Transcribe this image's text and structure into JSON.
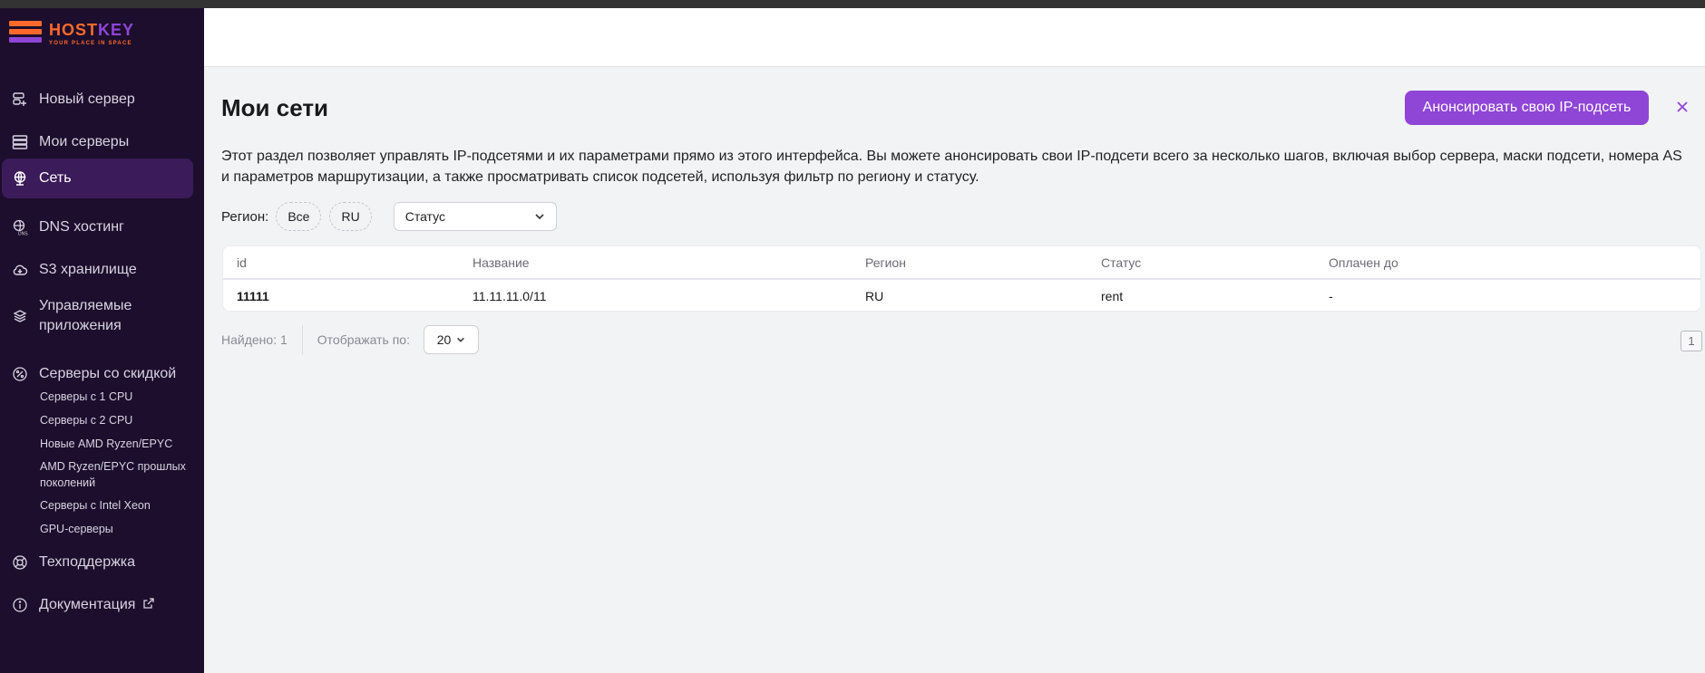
{
  "brand": {
    "name_part1": "HOST",
    "name_part2": "KEY",
    "tagline": "YOUR PLACE IN SPACE",
    "colors": {
      "orange": "#ff6a2c",
      "purple": "#8f45d6"
    }
  },
  "sidebar": {
    "items": [
      {
        "label": "Новый сервер",
        "icon": "server-plus-icon"
      },
      {
        "label": "Мои серверы",
        "icon": "servers-icon"
      },
      {
        "label": "Сеть",
        "icon": "globe-icon",
        "active": true
      },
      {
        "label": "DNS хостинг",
        "icon": "dns-icon"
      },
      {
        "label": "S3 хранилище",
        "icon": "cloud-icon"
      },
      {
        "label_line1": "Управляемые",
        "label_line2": "приложения",
        "icon": "layers-icon"
      },
      {
        "label": "Серверы со скидкой",
        "icon": "discount-icon"
      }
    ],
    "sub_items": [
      {
        "label": "Серверы с 1 CPU"
      },
      {
        "label": "Серверы с 2 CPU"
      },
      {
        "label": "Новые AMD Ryzen/EPYC"
      },
      {
        "label_line1": "AMD Ryzen/EPYC прошлых",
        "label_line2": "поколений"
      },
      {
        "label": "Серверы с Intel Xeon"
      },
      {
        "label": "GPU-серверы"
      }
    ],
    "bottom_items": [
      {
        "label": "Техподдержка",
        "icon": "lifebuoy-icon"
      },
      {
        "label": "Документация",
        "icon": "info-icon",
        "external": true
      }
    ]
  },
  "page": {
    "title": "Мои сети",
    "announce_button": "Анонсировать свою IP-подсеть",
    "description": "Этот раздел позволяет управлять IP-подсетями и их параметрами прямо из этого интерфейса. Вы можете анонсировать свои IP-подсети всего за несколько шагов, включая выбор сервера, маски подсети, номера AS и параметров маршрутизации, а также просматривать список подсетей, используя фильтр по региону и статусу."
  },
  "filters": {
    "region_label": "Регион:",
    "region_options": [
      "Все",
      "RU"
    ],
    "status_placeholder": "Статус"
  },
  "table": {
    "columns": [
      "id",
      "Название",
      "Регион",
      "Статус",
      "Оплачен до"
    ],
    "rows": [
      [
        "11111",
        "11.11.11.0/11",
        "RU",
        "rent",
        "-"
      ]
    ]
  },
  "footer": {
    "found": "Найдено: 1",
    "per_page_label": "Отображать по:",
    "per_page_value": "20",
    "current_page": "1"
  }
}
